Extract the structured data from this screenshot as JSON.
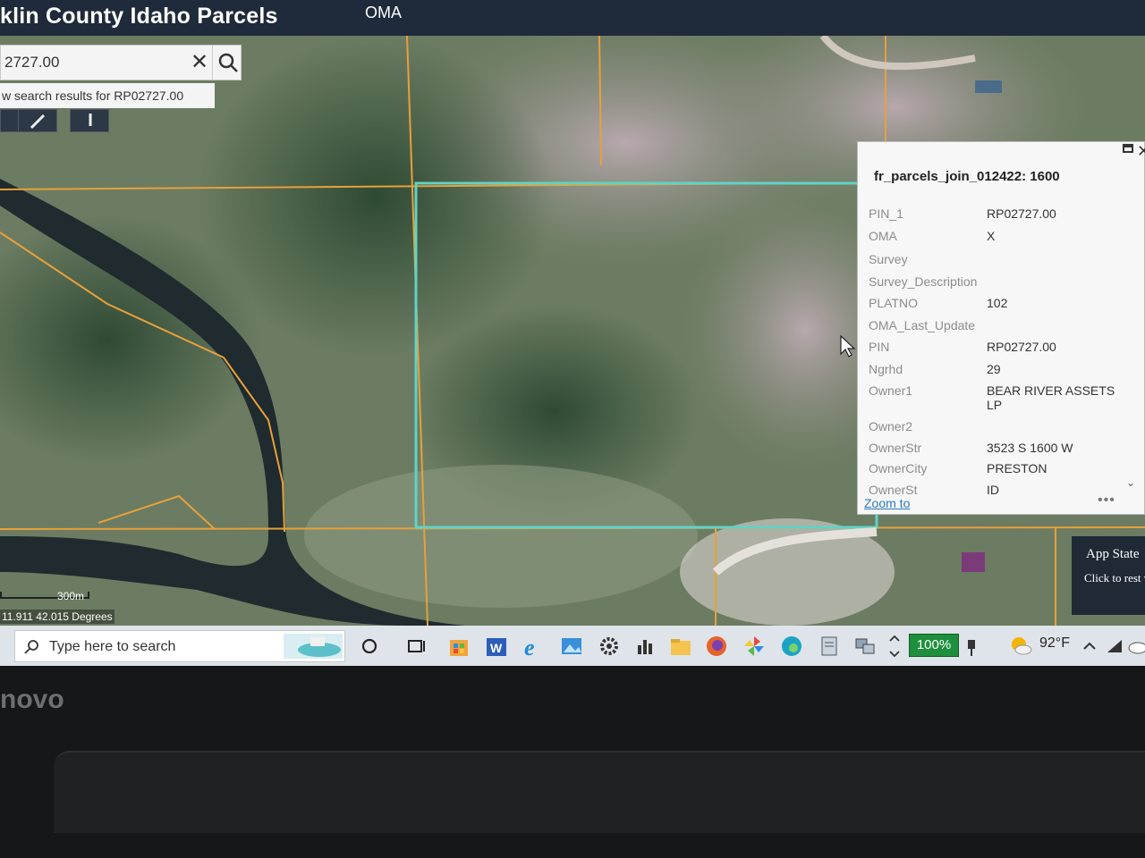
{
  "header": {
    "app_title": "klin County Idaho Parcels",
    "menu_oma": "OMA"
  },
  "search": {
    "value": "2727.00",
    "results_prefix": "w search results for ",
    "results_term": "RP02727.00"
  },
  "popup": {
    "title": "fr_parcels_join_012422: 1600",
    "attributes": [
      {
        "label": "PIN_1",
        "value": "RP02727.00"
      },
      {
        "label": "OMA",
        "value": "X"
      },
      {
        "label": "Survey",
        "value": ""
      },
      {
        "label": "Survey_Description",
        "value": ""
      },
      {
        "label": "PLATNO",
        "value": "102"
      },
      {
        "label": "OMA_Last_Update",
        "value": ""
      },
      {
        "label": "PIN",
        "value": "RP02727.00"
      },
      {
        "label": "Ngrhd",
        "value": "29"
      },
      {
        "label": "Owner1",
        "value": "BEAR RIVER ASSETS LP"
      },
      {
        "label": "Owner2",
        "value": ""
      },
      {
        "label": "OwnerStr",
        "value": "3523 S 1600 W"
      },
      {
        "label": "OwnerCity",
        "value": "PRESTON"
      },
      {
        "label": "OwnerSt",
        "value": "ID"
      }
    ],
    "zoom_to": "Zoom to",
    "more": "•••"
  },
  "map": {
    "scale_label": "300m",
    "coords": "11.911 42.015 Degrees",
    "parcel_line_color": "#e8a03a",
    "selected_parcel_color": "#5fd3c6"
  },
  "app_state": {
    "title": "App State",
    "message": "Click to rest visibility wh"
  },
  "taskbar": {
    "search_placeholder": "Type here to search",
    "battery": "100%",
    "temperature": "92°F"
  },
  "device": {
    "logo_text": "novo"
  }
}
